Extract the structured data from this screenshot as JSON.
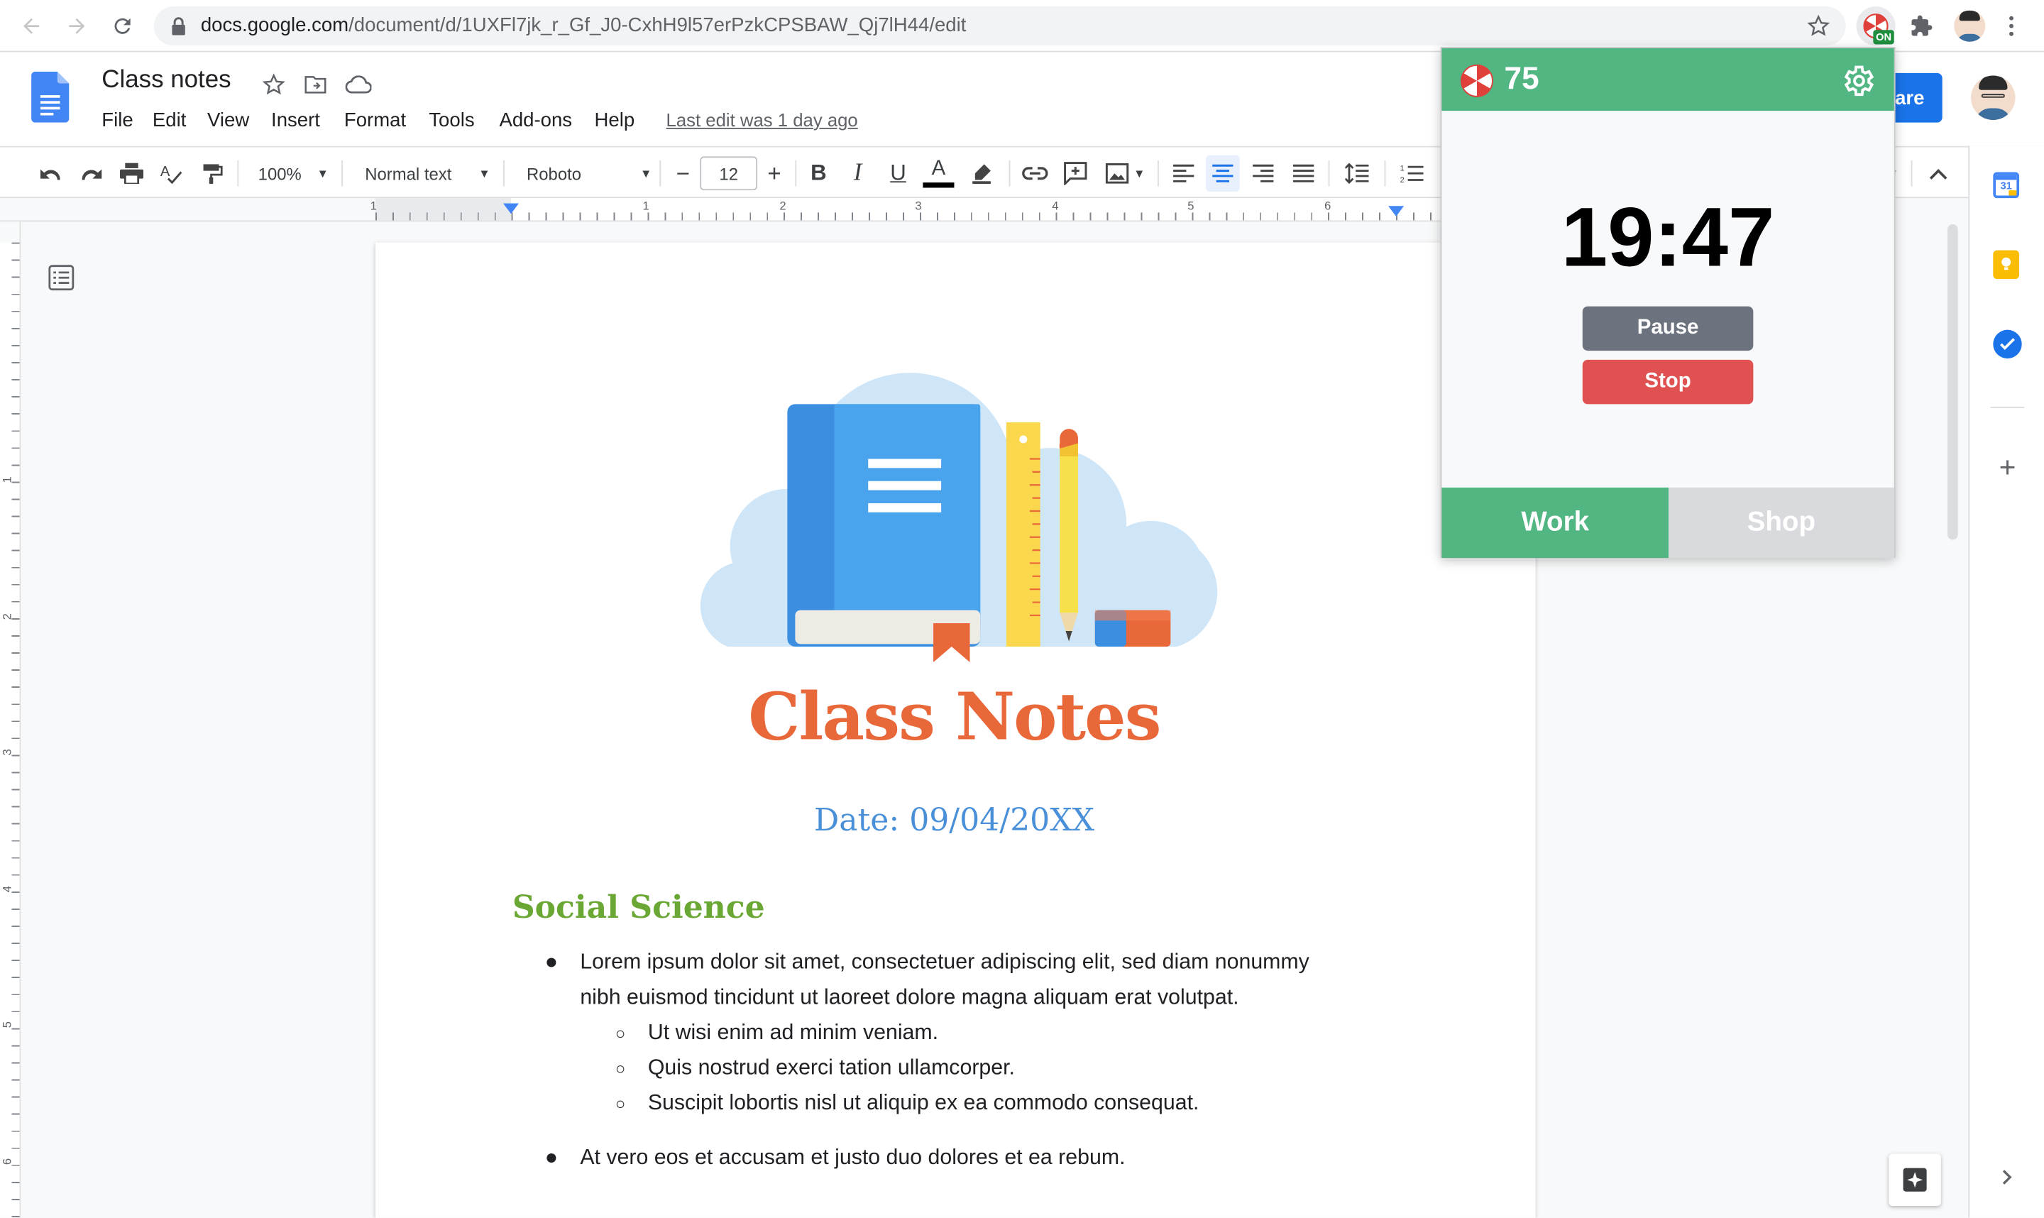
{
  "browser": {
    "url_host": "docs.google.com",
    "url_path": "/document/d/1UXFl7jk_r_Gf_J0-CxhH9l57erPzkCPSBAW_Qj7lH44/edit",
    "extension_badge": "ON"
  },
  "docs": {
    "title": "Class notes",
    "menu": [
      "File",
      "Edit",
      "View",
      "Insert",
      "Format",
      "Tools",
      "Add-ons",
      "Help"
    ],
    "last_edit": "Last edit was 1 day ago",
    "share_label": "are"
  },
  "toolbar": {
    "zoom": "100%",
    "style": "Normal text",
    "font": "Roboto",
    "font_size": "12"
  },
  "ruler": {
    "h_numbers": [
      "1",
      "1",
      "2",
      "3",
      "4",
      "5",
      "6"
    ],
    "v_numbers": [
      "1",
      "2",
      "3",
      "4",
      "5",
      "6"
    ]
  },
  "document": {
    "heading": "Class Notes",
    "date": "Date: 09/04/20XX",
    "section_title": "Social Science",
    "bullet_1_line_1": "Lorem ipsum dolor sit amet, consectetuer adipiscing elit, sed diam nonummy",
    "bullet_1_line_2": "nibh euismod tincidunt ut laoreet dolore magna aliquam erat volutpat.",
    "sub_bullets": [
      "Ut wisi enim ad minim veniam.",
      "Quis nostrud exerci tation ullamcorper.",
      "Suscipit lobortis nisl ut aliquip ex ea commodo consequat."
    ],
    "bullet_2": "At vero eos et accusam et justo duo dolores et ea rebum."
  },
  "popup": {
    "score": "75",
    "timer": "19:47",
    "pause_label": "Pause",
    "stop_label": "Stop",
    "tab_work": "Work",
    "tab_shop": "Shop",
    "colors": {
      "green": "#52b683",
      "stop_red": "#e05252",
      "pause_gray": "#6c737f"
    }
  }
}
